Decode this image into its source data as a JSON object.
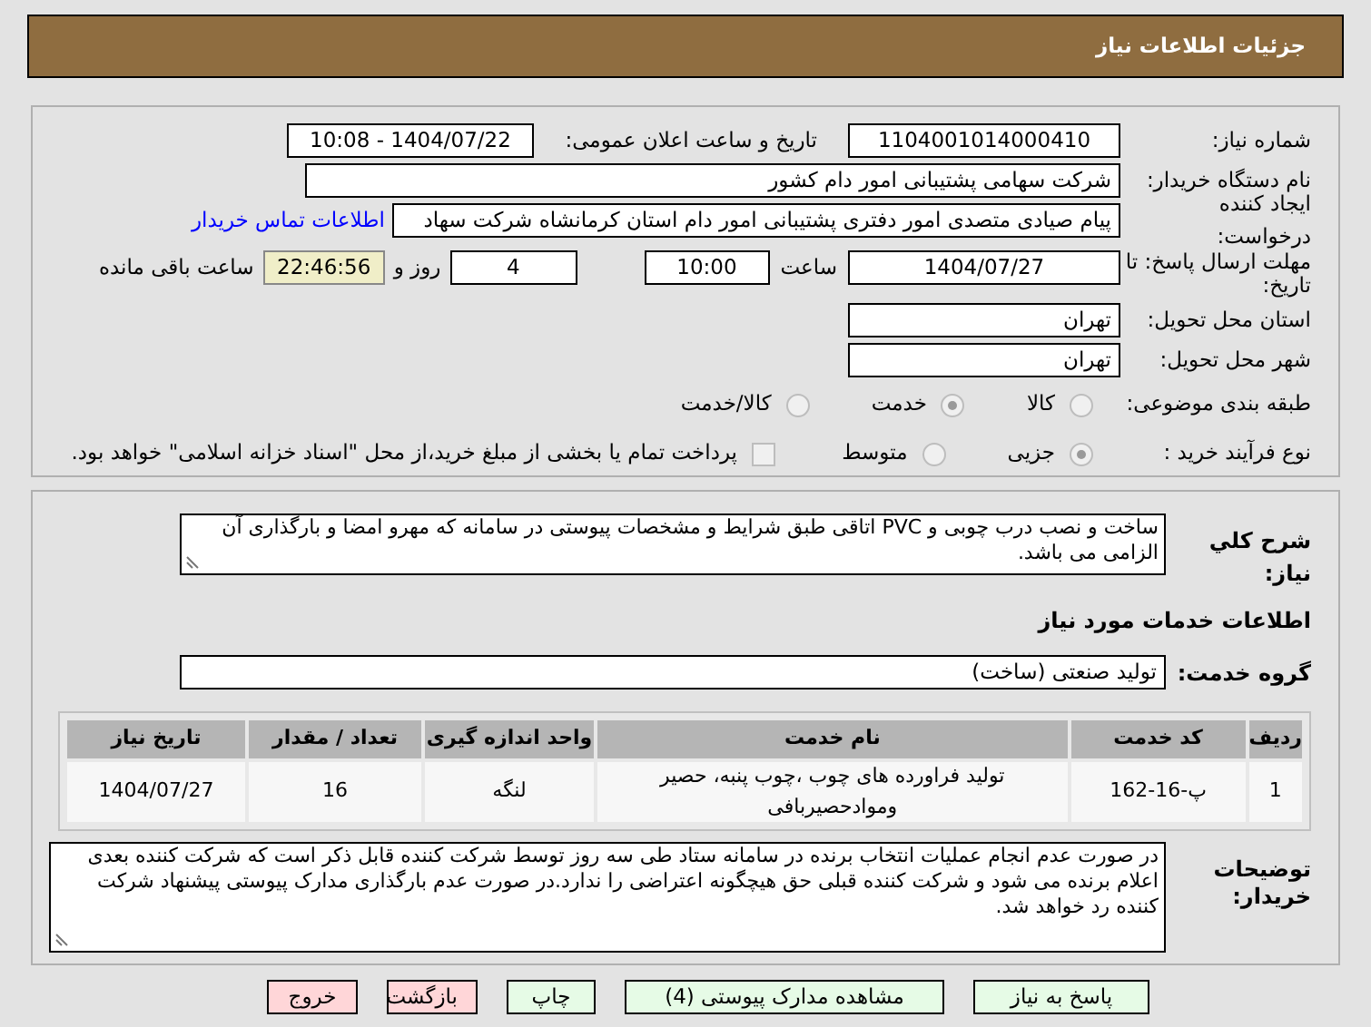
{
  "header": {
    "title": "جزئیات اطلاعات نیاز"
  },
  "need_number": {
    "label": "شماره نیاز:",
    "value": "1104001014000410"
  },
  "announce": {
    "label": "تاریخ و ساعت اعلان عمومی:",
    "value": "1404/07/22 - 10:08"
  },
  "buyer": {
    "label": "نام دستگاه خریدار:",
    "value": "شرکت سهامی پشتیبانی امور دام کشور"
  },
  "requester": {
    "label": "ایجاد کننده درخواست:",
    "value": "پیام صیادی متصدی امور دفتری پشتیبانی امور دام استان کرمانشاه شرکت سهاد",
    "link": "اطلاعات تماس خریدار"
  },
  "deadline": {
    "label": "مهلت ارسال پاسخ: تا تاریخ:",
    "date": "1404/07/27",
    "time_label": "ساعت",
    "time": "10:00",
    "days": "4",
    "days_label": "روز و",
    "remaining": "22:46:56",
    "remaining_label": "ساعت باقی مانده"
  },
  "province": {
    "label": "استان محل تحویل:",
    "value": "تهران"
  },
  "city": {
    "label": "شهر محل تحویل:",
    "value": "تهران"
  },
  "category": {
    "label": "طبقه بندی موضوعی:",
    "options": [
      {
        "label": "کالا",
        "selected": false
      },
      {
        "label": "خدمت",
        "selected": true
      },
      {
        "label": "کالا/خدمت",
        "selected": false
      }
    ]
  },
  "purchase_process": {
    "label": "نوع فرآیند خرید :",
    "options": [
      {
        "label": "جزیی",
        "selected": true
      },
      {
        "label": "متوسط",
        "selected": false
      }
    ],
    "payment_checkbox": {
      "label": "پرداخت تمام یا بخشی از مبلغ خرید،از محل \"اسناد خزانه اسلامی\" خواهد بود.",
      "checked": false
    }
  },
  "summary": {
    "label": "شرح کلي نياز:",
    "value": "ساخت و نصب درب چوبی و PVC اتاقی طبق شرایط و مشخصات پیوستی در سامانه که مهرو امضا و بارگذاری آن الزامی می باشد."
  },
  "services_heading": "اطلاعات خدمات مورد نیاز",
  "service_group": {
    "label": "گروه خدمت:",
    "value": "تولید صنعتی (ساخت)"
  },
  "table": {
    "columns": [
      "ردیف",
      "کد خدمت",
      "نام خدمت",
      "واحد اندازه گیری",
      "تعداد / مقدار",
      "تاریخ نیاز"
    ],
    "rows": [
      [
        "1",
        "پ-16-162",
        "تولید فراورده های چوب ،چوب پنبه، حصیر وموادحصیربافی",
        "لنگه",
        "16",
        "1404/07/27"
      ]
    ]
  },
  "buyer_notes": {
    "label": "توضیحات خریدار:",
    "value": "در صورت عدم انجام عملیات انتخاب برنده در سامانه ستاد طی سه روز توسط شرکت کننده قابل ذکر است که شرکت کننده بعدی اعلام برنده می شود و شرکت کننده قبلی حق هیچگونه اعتراضی را ندارد.در صورت عدم بارگذاری مدارک پیوستی پیشنهاد شرکت کننده رد خواهد شد."
  },
  "buttons": [
    {
      "label": "پاسخ به نیاز",
      "kind": "action"
    },
    {
      "label": "مشاهده مدارک پیوستی (4)",
      "kind": "action"
    },
    {
      "label": "چاپ",
      "kind": "action"
    },
    {
      "label": "بازگشت",
      "kind": "exit"
    },
    {
      "label": "خروج",
      "kind": "exit"
    }
  ]
}
